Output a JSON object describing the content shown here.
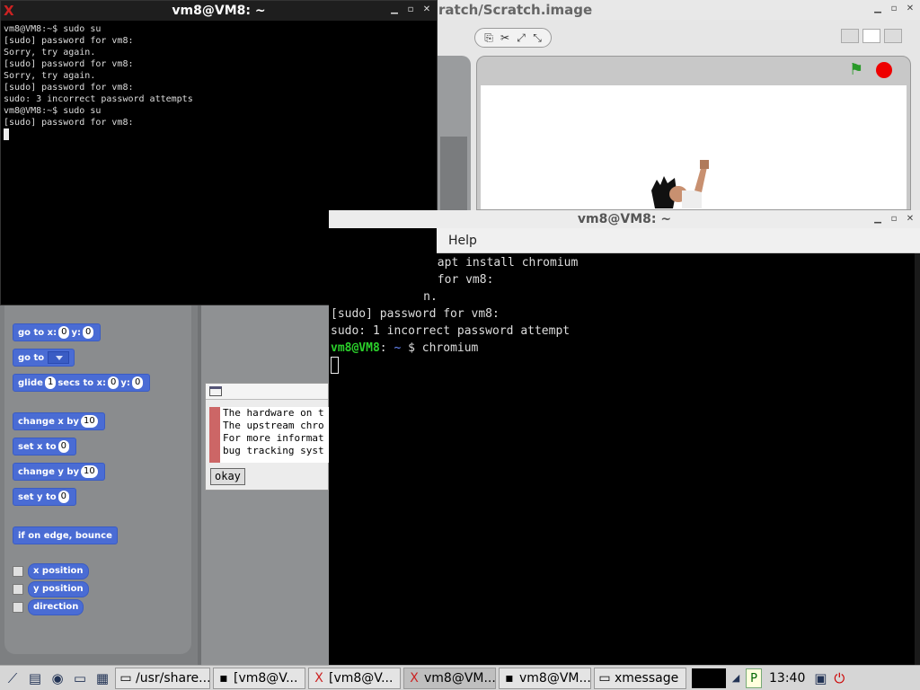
{
  "scratch_window": {
    "title": "ratch/Scratch.image",
    "controls": {
      "minimize": "▁",
      "maximize": "▫",
      "close": "✕"
    }
  },
  "term1": {
    "title": "vm8@VM8: ~",
    "lines": [
      "vm8@VM8:~$ sudo su",
      "[sudo] password for vm8:",
      "Sorry, try again.",
      "[sudo] password for vm8:",
      "Sorry, try again.",
      "[sudo] password for vm8:",
      "sudo: 3 incorrect password attempts",
      "vm8@VM8:~$ sudo su",
      "[sudo] password for vm8:"
    ]
  },
  "blocks": {
    "goto_xy": {
      "label": "go to x:",
      "x": "0",
      "ylabel": "y:",
      "y": "0"
    },
    "goto": {
      "label": "go to"
    },
    "glide": {
      "label": "glide",
      "secs": "1",
      "mid": "secs to x:",
      "x": "0",
      "ylabel": "y:",
      "y": "0"
    },
    "change_x": {
      "label": "change x by",
      "value": "10"
    },
    "set_x": {
      "label": "set x to",
      "value": "0"
    },
    "change_y": {
      "label": "change y by",
      "value": "10"
    },
    "set_y": {
      "label": "set y to",
      "value": "0"
    },
    "bounce": {
      "label": "if on edge, bounce"
    },
    "x_position": "x position",
    "y_position": "y position",
    "direction": "direction"
  },
  "dialog": {
    "lines": [
      "The hardware on t",
      "The upstream chro",
      "For more informat",
      "bug tracking syst"
    ],
    "button": "okay"
  },
  "term2": {
    "title": "vm8@VM8: ~",
    "menu": "Help",
    "lines": [
      "       apt install chromium",
      "       for vm8:",
      "     n.",
      "[sudo] password for vm8:",
      "sudo: 1 incorrect password attempt"
    ],
    "prompt_user": "vm8@VM8",
    "prompt_sep": ": ",
    "prompt_path": "~",
    "prompt_cmd": " $ chromium"
  },
  "taskbar": {
    "tasks": [
      "/usr/share...",
      "[vm8@V...",
      "[vm8@V...",
      "vm8@VM...",
      "vm8@VM...",
      "xmessage"
    ],
    "clock": "13:40"
  }
}
